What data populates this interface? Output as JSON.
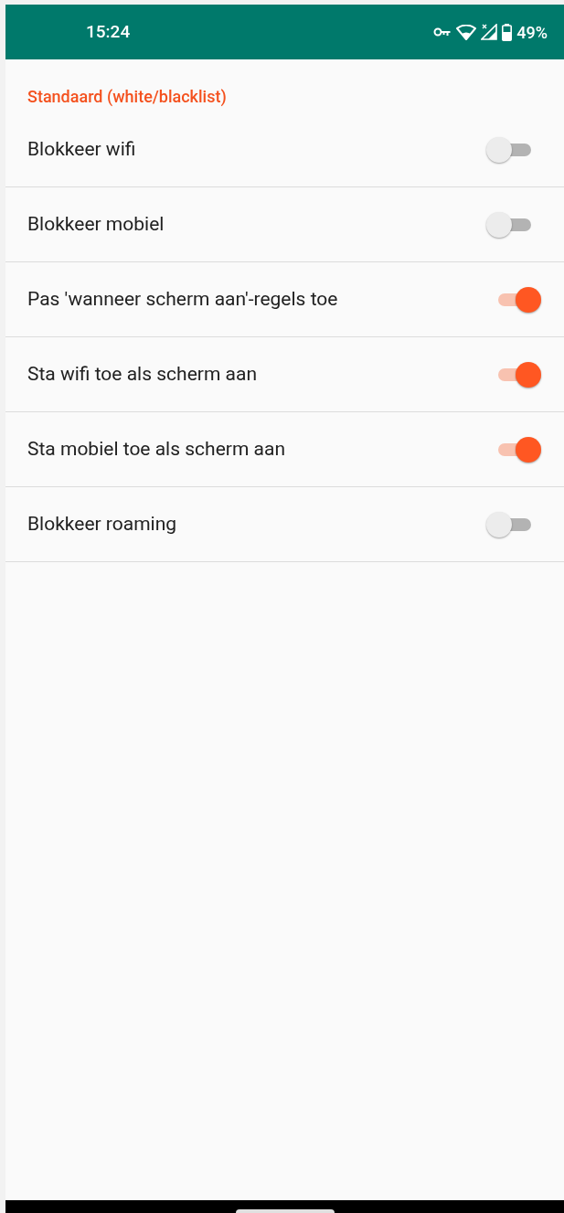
{
  "status_bar": {
    "time": "15:24",
    "battery": "49%"
  },
  "section": {
    "title": "Standaard (white/blacklist)"
  },
  "settings": [
    {
      "label": "Blokkeer wifi",
      "on": false
    },
    {
      "label": "Blokkeer mobiel",
      "on": false
    },
    {
      "label": "Pas 'wanneer scherm aan'-regels toe",
      "on": true
    },
    {
      "label": "Sta wifi toe als scherm aan",
      "on": true
    },
    {
      "label": "Sta mobiel toe als scherm aan",
      "on": true
    },
    {
      "label": "Blokkeer roaming",
      "on": false
    }
  ]
}
